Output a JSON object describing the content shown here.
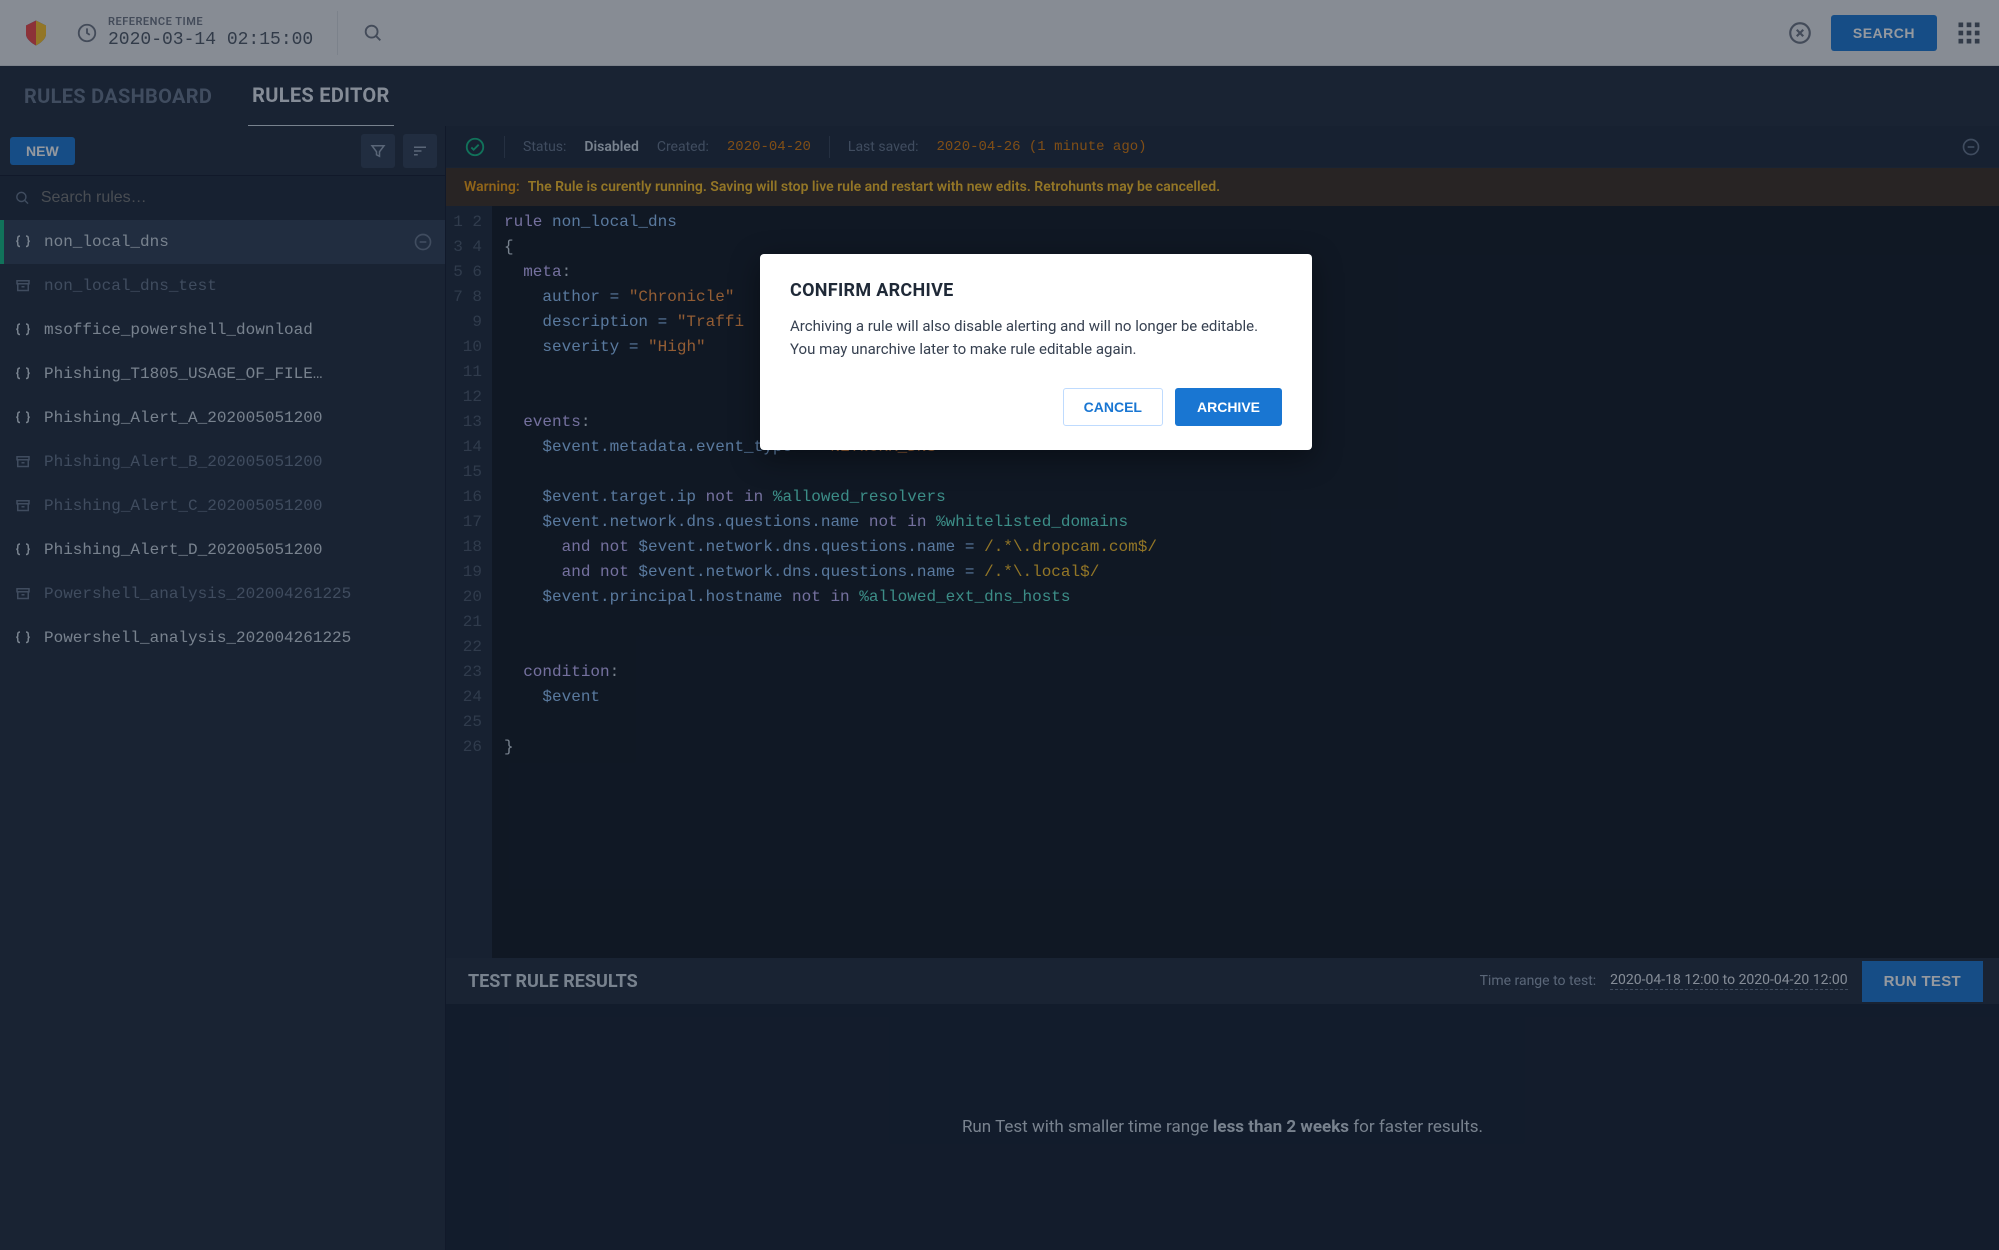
{
  "topBar": {
    "refTimeLabel": "REFERENCE TIME",
    "refTimeValue": "2020-03-14 02:15:00",
    "searchButton": "SEARCH"
  },
  "navTabs": {
    "dashboard": "RULES DASHBOARD",
    "editor": "RULES EDITOR"
  },
  "sidebar": {
    "newButton": "NEW",
    "searchPlaceholder": "Search rules…",
    "rules": [
      {
        "name": "non_local_dns",
        "type": "braces",
        "active": true,
        "muted": false,
        "showMinus": true
      },
      {
        "name": "non_local_dns_test",
        "type": "archive",
        "active": false,
        "muted": true,
        "showMinus": false
      },
      {
        "name": "msoffice_powershell_download",
        "type": "braces",
        "active": false,
        "muted": false,
        "showMinus": false
      },
      {
        "name": "Phishing_T1805_USAGE_OF_FILE…",
        "type": "braces",
        "active": false,
        "muted": false,
        "showMinus": false
      },
      {
        "name": "Phishing_Alert_A_202005051200",
        "type": "braces",
        "active": false,
        "muted": false,
        "showMinus": false
      },
      {
        "name": "Phishing_Alert_B_202005051200",
        "type": "archive",
        "active": false,
        "muted": true,
        "showMinus": false
      },
      {
        "name": "Phishing_Alert_C_202005051200",
        "type": "archive",
        "active": false,
        "muted": true,
        "showMinus": false
      },
      {
        "name": "Phishing_Alert_D_202005051200",
        "type": "braces",
        "active": false,
        "muted": false,
        "showMinus": false
      },
      {
        "name": "Powershell_analysis_202004261225",
        "type": "archive",
        "active": false,
        "muted": true,
        "showMinus": false
      },
      {
        "name": "Powershell_analysis_202004261225",
        "type": "braces",
        "active": false,
        "muted": false,
        "showMinus": false
      }
    ]
  },
  "statusBar": {
    "statusLabel": "Status:",
    "statusValue": "Disabled",
    "createdLabel": "Created:",
    "createdValue": "2020-04-20",
    "savedLabel": "Last saved:",
    "savedValue": "2020-04-26 (1 minute ago)"
  },
  "warning": {
    "prefix": "Warning:",
    "text": "The Rule is curently running.  Saving will stop  live rule and restart with new edits.  Retrohunts may be cancelled."
  },
  "code": {
    "l1a": "rule",
    "l1b": " non_local_dns",
    "l2": "{",
    "l3a": "  meta",
    "l3b": ":",
    "l4a": "    author = ",
    "l4b": "\"Chronicle\"",
    "l5a": "    description = ",
    "l5b": "\"Traffi",
    "l6a": "    severity = ",
    "l6b": "\"High\"",
    "l9a": "  events",
    "l9b": ":",
    "l10a": "    $event.metadata.event_type = ",
    "l10b": "\"NETWORK_DNS\"",
    "l12a": "    $event.target.ip ",
    "l12b": "not in",
    "l12c": " %allowed_resolvers",
    "l13a": "    $event.network.dns.questions.name ",
    "l13b": "not in",
    "l13c": " %whitelisted_domains",
    "l14a": "      and not",
    "l14b": " $event.network.dns.questions.name = ",
    "l14c": "/.*\\.dropcam.com$/",
    "l15a": "      and not",
    "l15b": " $event.network.dns.questions.name = ",
    "l15c": "/.*\\.local$/",
    "l16a": "    $event.principal.hostname ",
    "l16b": "not in",
    "l16c": " %allowed_ext_dns_hosts",
    "l19a": "  condition",
    "l19b": ":",
    "l20": "    $event",
    "l22": "}"
  },
  "testPanel": {
    "title": "TEST RULE RESULTS",
    "rangeLabel": "Time range to test:",
    "rangeValue": "2020-04-18 12:00 to 2020-04-20 12:00",
    "runButton": "RUN TEST",
    "hintPrefix": "Run Test with smaller time range ",
    "hintBold": "less than 2 weeks",
    "hintSuffix": " for faster results."
  },
  "modal": {
    "title": "CONFIRM ARCHIVE",
    "body": "Archiving a rule will also disable alerting  and will no longer be editable. You may unarchive later to make rule editable again.",
    "cancel": "CANCEL",
    "archive": "ARCHIVE"
  }
}
